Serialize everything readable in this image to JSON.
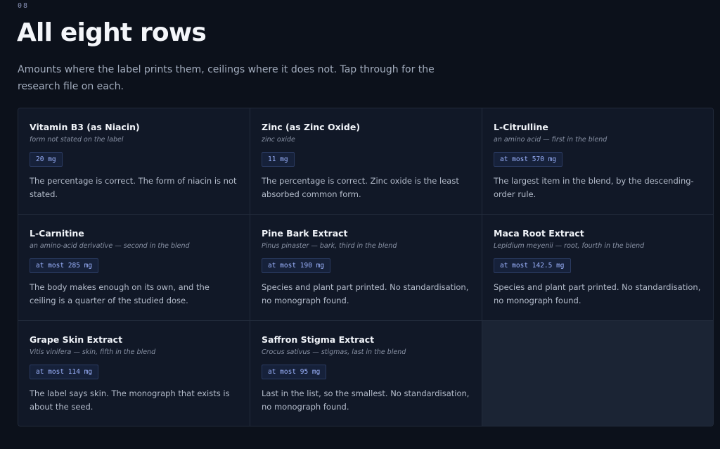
{
  "section": {
    "number": "08",
    "title": "All eight rows",
    "intro": "Amounts where the label prints them, ceilings where it does not. Tap through for the research file on each."
  },
  "cards": [
    {
      "name": "Vitamin B3 (as Niacin)",
      "subtitle": "form not stated on the label",
      "amount": "20 mg",
      "body": "The percentage is correct. The form of niacin is not stated."
    },
    {
      "name": "Zinc (as Zinc Oxide)",
      "subtitle": "zinc oxide",
      "amount": "11 mg",
      "body": "The percentage is correct. Zinc oxide is the least absorbed common form."
    },
    {
      "name": "L-Citrulline",
      "subtitle": "an amino acid — first in the blend",
      "amount": "at most 570 mg",
      "body": "The largest item in the blend, by the descending-order rule."
    },
    {
      "name": "L-Carnitine",
      "subtitle": "an amino-acid derivative — second in the blend",
      "amount": "at most 285 mg",
      "body": "The body makes enough on its own, and the ceiling is a quarter of the studied dose."
    },
    {
      "name": "Pine Bark Extract",
      "subtitle": "Pinus pinaster — bark, third in the blend",
      "amount": "at most 190 mg",
      "body": "Species and plant part printed. No standardisation, no monograph found."
    },
    {
      "name": "Maca Root Extract",
      "subtitle": "Lepidium meyenii — root, fourth in the blend",
      "amount": "at most 142.5 mg",
      "body": "Species and plant part printed. No standardisation, no monograph found."
    },
    {
      "name": "Grape Skin Extract",
      "subtitle": "Vitis vinifera — skin, fifth in the blend",
      "amount": "at most 114 mg",
      "body": "The label says skin. The monograph that exists is about the seed."
    },
    {
      "name": "Saffron Stigma Extract",
      "subtitle": "Crocus sativus — stigmas, last in the blend",
      "amount": "at most 95 mg",
      "body": "Last in the list, so the smallest. No standardisation, no monograph found."
    }
  ]
}
